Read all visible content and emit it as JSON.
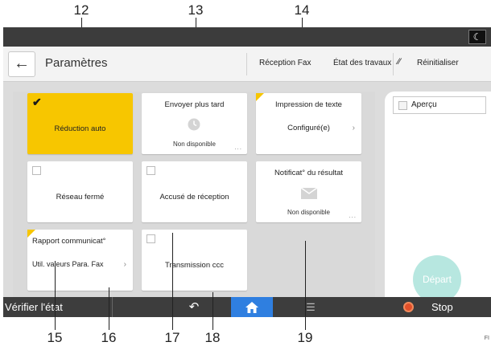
{
  "callouts": {
    "top": [
      "12",
      "13",
      "14"
    ],
    "bottom": [
      "15",
      "16",
      "17",
      "18",
      "19"
    ]
  },
  "figure_id": "FI",
  "status_bar": {
    "icon": "moon-icon"
  },
  "header": {
    "back_icon": "arrow-left-icon",
    "title": "Paramètres",
    "reception_fax": "Réception Fax",
    "etat_travaux": "État des travaux",
    "reinitialiser": "Réinitialiser",
    "reset_icon": "double-slash-icon"
  },
  "tiles": {
    "reduction_auto": {
      "label": "Réduction auto",
      "checked": true,
      "color": "#f7c600"
    },
    "envoyer_plus_tard": {
      "label": "Envoyer plus tard",
      "status": "Non disponible",
      "icon": "clock-icon"
    },
    "impression_texte": {
      "label": "Impression de texte",
      "value": "Configuré(e)"
    },
    "reseau_ferme": {
      "label": "Réseau fermé"
    },
    "accuse_reception": {
      "label": "Accusé de réception"
    },
    "notificat_resultat": {
      "label": "Notificat° du résultat",
      "status": "Non disponible",
      "icon": "envelope-icon"
    },
    "rapport_communicat": {
      "label": "Rapport communicat°",
      "value": "Util. valeurs Para. Fax"
    },
    "transmission_ccc": {
      "label": "Transmission ccc"
    }
  },
  "side_panel": {
    "apercu_label": "Aperçu",
    "depart_label": "Départ",
    "depart_color": "#b7e7e0"
  },
  "bottom_bar": {
    "verifier_etat": "Vérifier l'état",
    "undo_icon": "undo-icon",
    "home_icon": "home-icon",
    "menu_icon": "menu-icon",
    "stop_label": "Stop",
    "home_color": "#2f7fe0"
  }
}
